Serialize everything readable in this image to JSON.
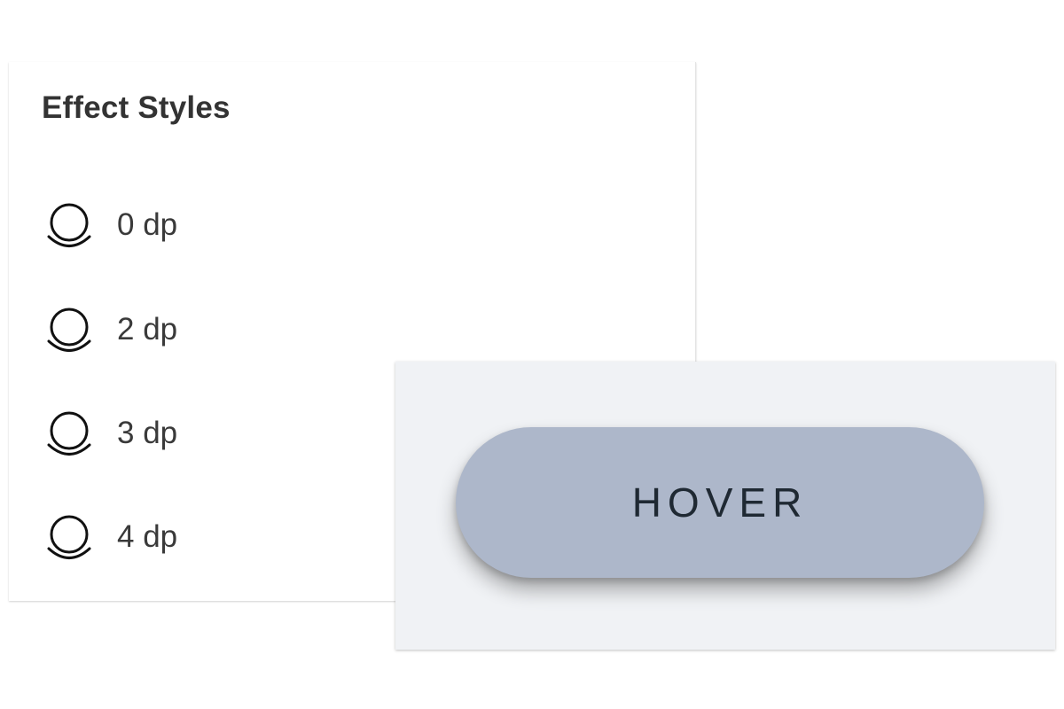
{
  "effect_styles": {
    "title": "Effect Styles",
    "items": [
      {
        "label": "0 dp",
        "icon": "elevation-icon"
      },
      {
        "label": "2 dp",
        "icon": "elevation-icon"
      },
      {
        "label": "3 dp",
        "icon": "elevation-icon"
      },
      {
        "label": "4 dp",
        "icon": "elevation-icon"
      }
    ]
  },
  "preview": {
    "button_label": "HOVER",
    "button_state": "hover",
    "background_color": "#f0f2f5",
    "button_color": "#adb7ca",
    "text_color": "#1f2933"
  }
}
